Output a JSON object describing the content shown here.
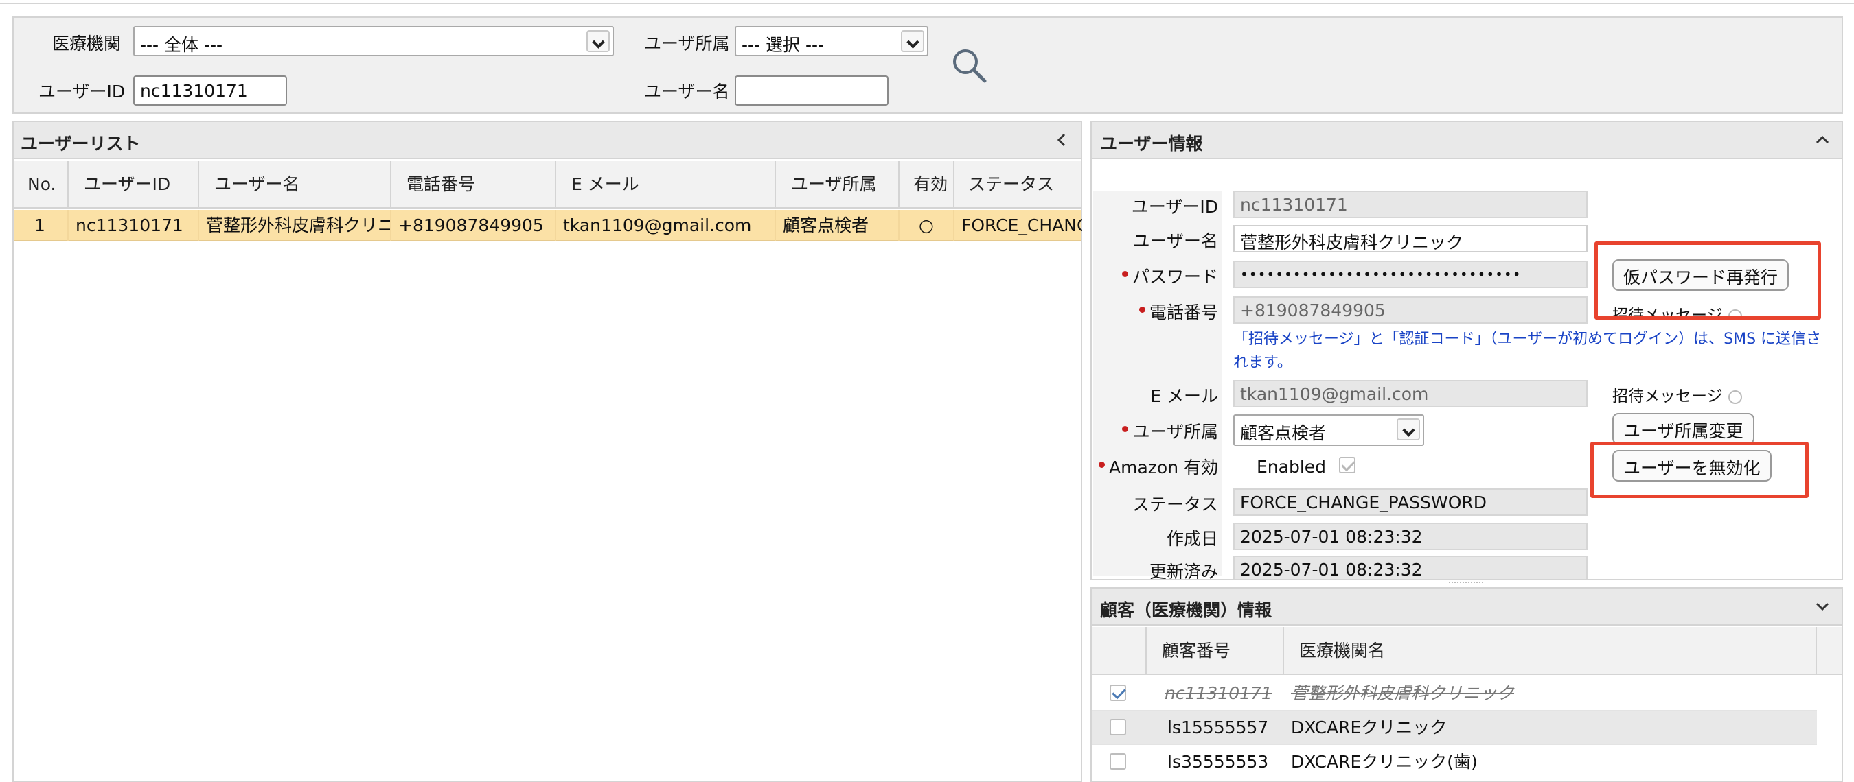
{
  "search": {
    "facility_label": "医療機関",
    "facility_value": "--- 全体 ---",
    "affiliation_label": "ユーザ所属",
    "affiliation_value": "--- 選択 ---",
    "userid_label": "ユーザーID",
    "userid_value": "nc11310171",
    "username_label": "ユーザー名",
    "username_value": ""
  },
  "user_list": {
    "title": "ユーザーリスト",
    "columns": [
      "No.",
      "ユーザーID",
      "ユーザー名",
      "電話番号",
      "E メール",
      "ユーザ所属",
      "有効",
      "ステータス"
    ],
    "rows": [
      {
        "no": "1",
        "user_id": "nc11310171",
        "user_name": "菅整形外科皮膚科クリニック",
        "phone": "+819087849905",
        "email": "tkan1109@gmail.com",
        "affiliation": "顧客点検者",
        "enabled": "○",
        "status": "FORCE_CHANGE_PASSWORD"
      }
    ]
  },
  "user_info": {
    "title": "ユーザー情報",
    "fields": {
      "user_id_label": "ユーザーID",
      "user_id": "nc11310171",
      "user_name_label": "ユーザー名",
      "user_name": "菅整形外科皮膚科クリニック",
      "password_label": "パスワード",
      "password": "••••••••••••••••••••••••••••••••",
      "phone_label": "電話番号",
      "phone": "+819087849905",
      "sms_note": "「招待メッセージ」と「認証コード」（ユーザーが初めてログイン）は、SMS に送信されます。",
      "email_label": "E メール",
      "email": "tkan1109@gmail.com",
      "affiliation_label": "ユーザ所属",
      "affiliation": "顧客点検者",
      "amazon_label": "Amazon 有効",
      "amazon_value": "Enabled",
      "amazon_checked": true,
      "status_label": "ステータス",
      "status": "FORCE_CHANGE_PASSWORD",
      "created_label": "作成日",
      "created": "2025-07-01 08:23:32",
      "updated_label": "更新済み",
      "updated": "2025-07-01 08:23:32"
    },
    "buttons": {
      "reissue_password": "仮パスワード再発行",
      "invite_message": "招待メッセージ",
      "change_affiliation": "ユーザ所属変更",
      "disable_user": "ユーザーを無効化"
    },
    "highlight_color": "#e8432e"
  },
  "customer_info": {
    "title": "顧客（医療機関）情報",
    "columns": [
      "顧客番号",
      "医療機関名"
    ],
    "rows": [
      {
        "checked": true,
        "struck": true,
        "number": "nc11310171",
        "name": "菅整形外科皮膚科クリニック"
      },
      {
        "checked": false,
        "struck": false,
        "number": "ls15555557",
        "name": "DXCAREクリニック"
      },
      {
        "checked": false,
        "struck": false,
        "number": "ls35555553",
        "name": "DXCAREクリニック(歯)"
      }
    ]
  },
  "colors": {
    "selected_row": "#fbe1a6",
    "required_marker": "#c81e1e",
    "note_text": "#1a44c6"
  }
}
